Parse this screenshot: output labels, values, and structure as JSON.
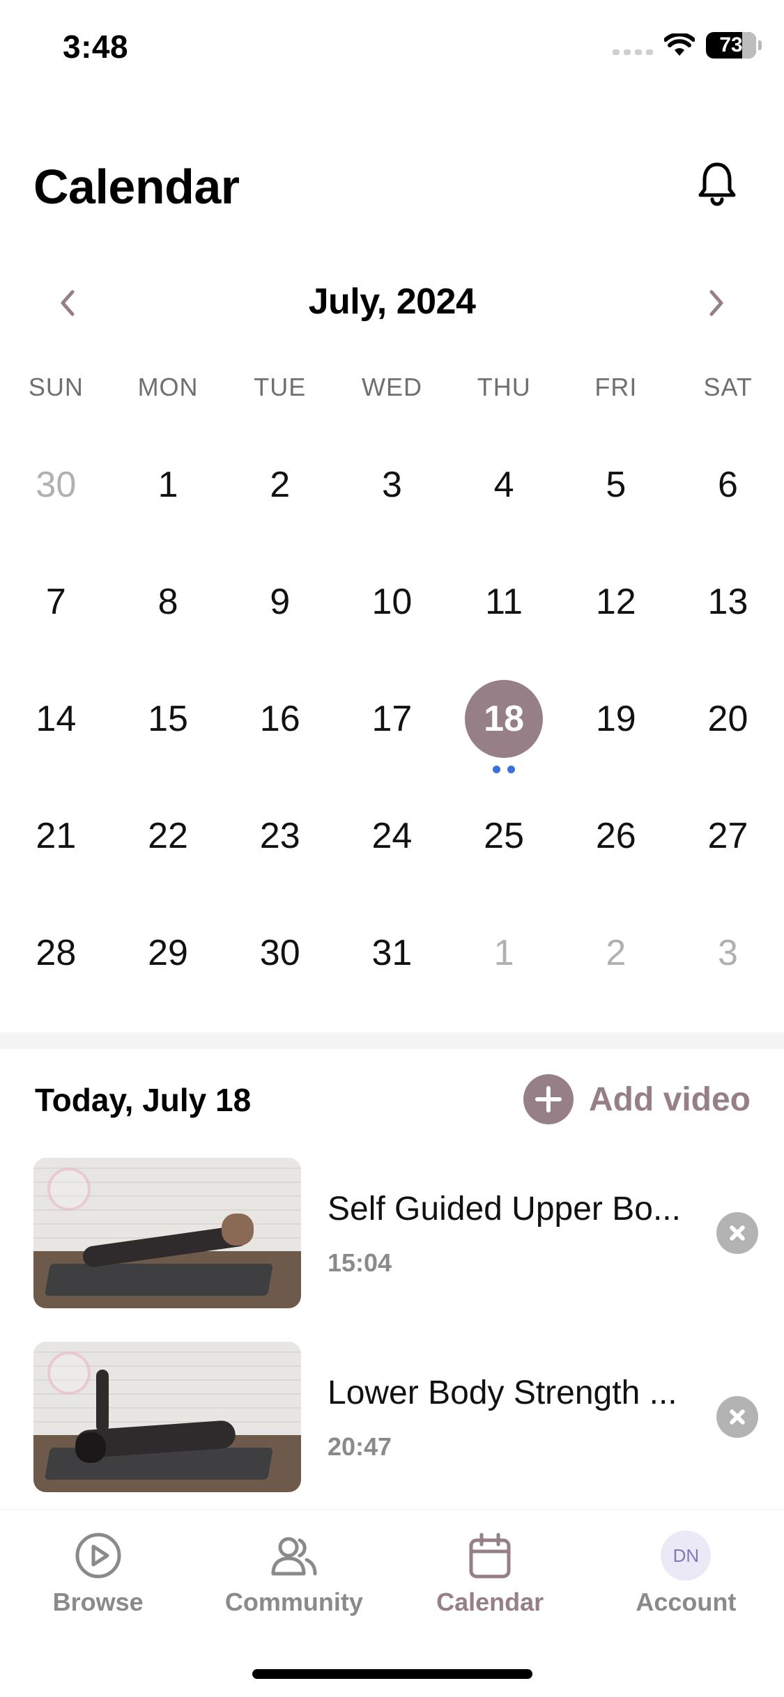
{
  "status_bar": {
    "time": "3:48",
    "battery": "73"
  },
  "header": {
    "title": "Calendar"
  },
  "calendar": {
    "month_label": "July, 2024",
    "weekdays": [
      "SUN",
      "MON",
      "TUE",
      "WED",
      "THU",
      "FRI",
      "SAT"
    ],
    "weeks": [
      [
        "30",
        "1",
        "2",
        "3",
        "4",
        "5",
        "6"
      ],
      [
        "7",
        "8",
        "9",
        "10",
        "11",
        "12",
        "13"
      ],
      [
        "14",
        "15",
        "16",
        "17",
        "18",
        "19",
        "20"
      ],
      [
        "21",
        "22",
        "23",
        "24",
        "25",
        "26",
        "27"
      ],
      [
        "28",
        "29",
        "30",
        "31",
        "1",
        "2",
        "3"
      ]
    ],
    "selected_day": "18",
    "event_dot_count": 2
  },
  "today": {
    "title": "Today, July 18",
    "add_label": "Add video",
    "videos": [
      {
        "title": "Self Guided Upper Bo...",
        "duration": "15:04"
      },
      {
        "title": "Lower Body Strength ...",
        "duration": "20:47"
      }
    ]
  },
  "tabs": [
    {
      "label": "Browse"
    },
    {
      "label": "Community"
    },
    {
      "label": "Calendar"
    },
    {
      "label": "Account",
      "initials": "DN"
    }
  ],
  "colors": {
    "accent": "#967f87",
    "event_dot": "#3a6fdc",
    "muted_text": "#8a8a8a"
  }
}
